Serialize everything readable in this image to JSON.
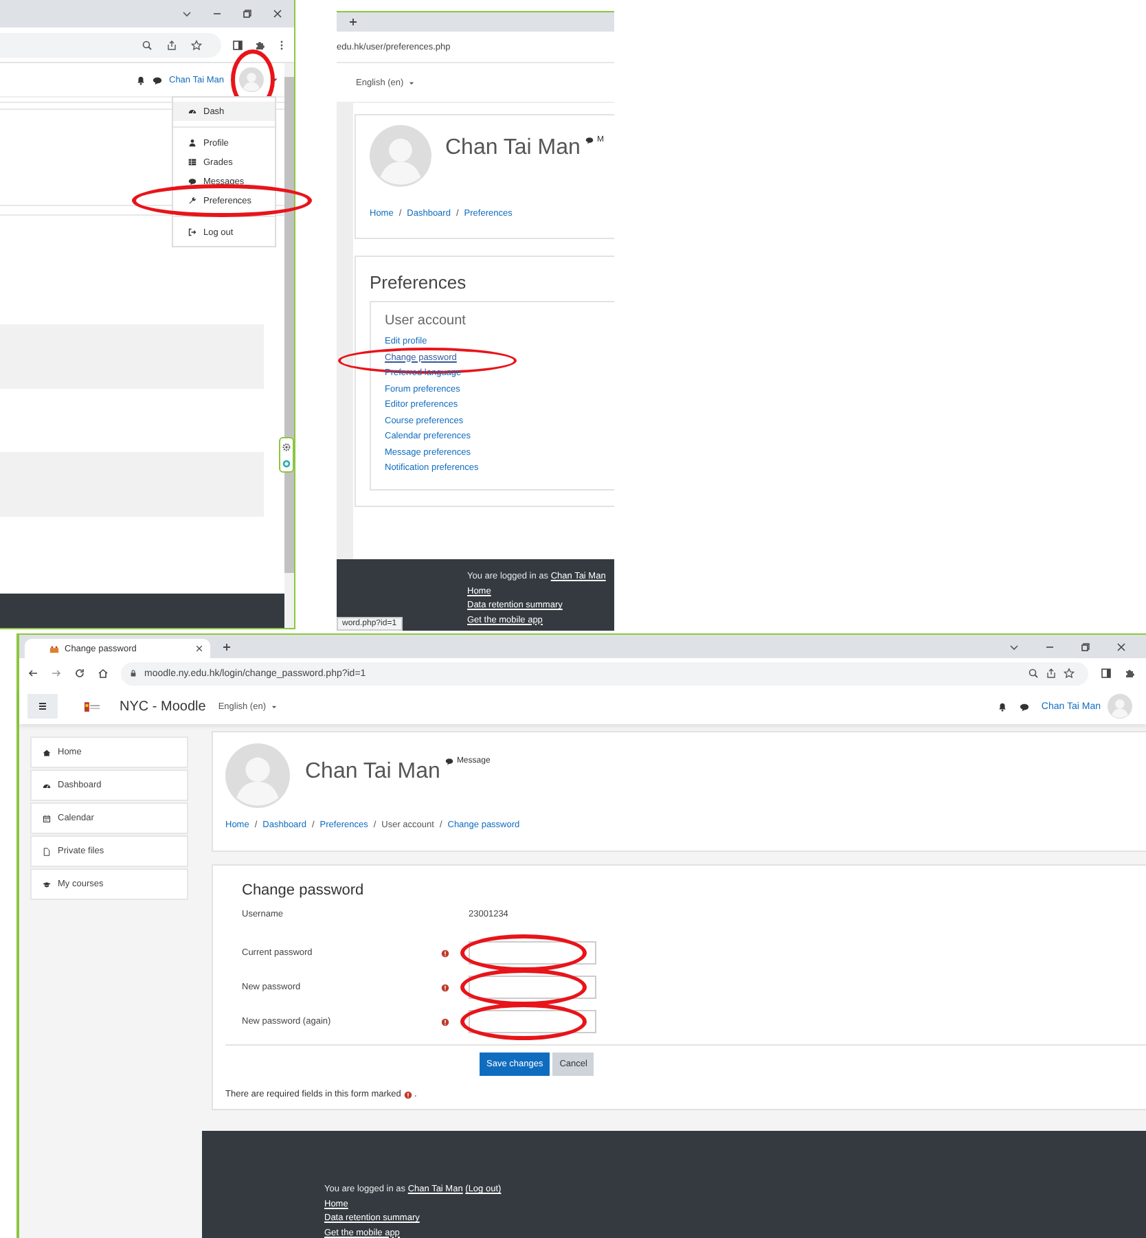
{
  "menu_step": {
    "user_name": "Chan Tai Man",
    "avatar_highlighted": true,
    "menu": [
      {
        "label": "Dash",
        "highlighted": false,
        "divider_after": true
      },
      {
        "label": "Profile",
        "highlighted": false,
        "divider_after": false
      },
      {
        "label": "Grades",
        "highlighted": false,
        "divider_after": false
      },
      {
        "label": "Messages",
        "highlighted": false,
        "divider_after": false
      },
      {
        "label": "Preferences",
        "highlighted": true,
        "divider_after": true
      },
      {
        "label": "Log out",
        "highlighted": false,
        "divider_after": false
      }
    ]
  },
  "preferences_step": {
    "url": "edu.hk/user/preferences.php",
    "language": "English (en)",
    "profile_name": "Chan Tai Man",
    "message_label": "M",
    "breadcrumb_separator": "/",
    "breadcrumb": [
      {
        "label": "Home",
        "link": true
      },
      {
        "label": "Dashboard",
        "link": true
      },
      {
        "label": "Preferences",
        "link": true
      }
    ],
    "heading": "Preferences",
    "section": "User account",
    "links": [
      {
        "label": "Edit profile",
        "highlighted": false
      },
      {
        "label": "Change password",
        "highlighted": true
      },
      {
        "label": "Preferred language",
        "highlighted": false
      },
      {
        "label": "Forum preferences",
        "highlighted": false
      },
      {
        "label": "Editor preferences",
        "highlighted": false
      },
      {
        "label": "Course preferences",
        "highlighted": false
      },
      {
        "label": "Calendar preferences",
        "highlighted": false
      },
      {
        "label": "Message preferences",
        "highlighted": false
      },
      {
        "label": "Notification preferences",
        "highlighted": false
      }
    ],
    "footer": {
      "prefix": "You are logged in as ",
      "user_link": "Chan Tai Man",
      "links": [
        "Home",
        "Data retention summary",
        "Get the mobile app"
      ]
    },
    "status_url": "word.php?id=1"
  },
  "change_password_step": {
    "tab_title": "Change password",
    "url": "moodle.ny.edu.hk/login/change_password.php?id=1",
    "site_name": "NYC - Moodle",
    "language": "English (en)",
    "user_name": "Chan Tai Man",
    "nav": [
      {
        "label": "Home"
      },
      {
        "label": "Dashboard"
      },
      {
        "label": "Calendar"
      },
      {
        "label": "Private files"
      },
      {
        "label": "My courses"
      }
    ],
    "profile_name": "Chan Tai Man",
    "message_label": "Message",
    "breadcrumb_separator": "/",
    "breadcrumb": [
      {
        "label": "Home",
        "link": true
      },
      {
        "label": "Dashboard",
        "link": true
      },
      {
        "label": "Preferences",
        "link": true
      },
      {
        "label": "User account",
        "link": false
      },
      {
        "label": "Change password",
        "link": true
      }
    ],
    "form_title": "Change password",
    "username_label": "Username",
    "username_value": "23001234",
    "fields": [
      {
        "label": "Current password",
        "required": true,
        "highlighted": true
      },
      {
        "label": "New password",
        "required": true,
        "highlighted": true
      },
      {
        "label": "New password (again)",
        "required": true,
        "highlighted": true
      }
    ],
    "buttons": [
      {
        "label": "Save changes",
        "kind": "primary"
      },
      {
        "label": "Cancel",
        "kind": "secondary"
      }
    ],
    "required_note": {
      "text": "There are required fields in this form marked",
      "suffix": "."
    },
    "footer": {
      "prefix": "You are logged in as ",
      "user_link": "Chan Tai Man",
      "logout_link": "(Log out)",
      "links": [
        "Home",
        "Data retention summary",
        "Get the mobile app"
      ]
    }
  }
}
